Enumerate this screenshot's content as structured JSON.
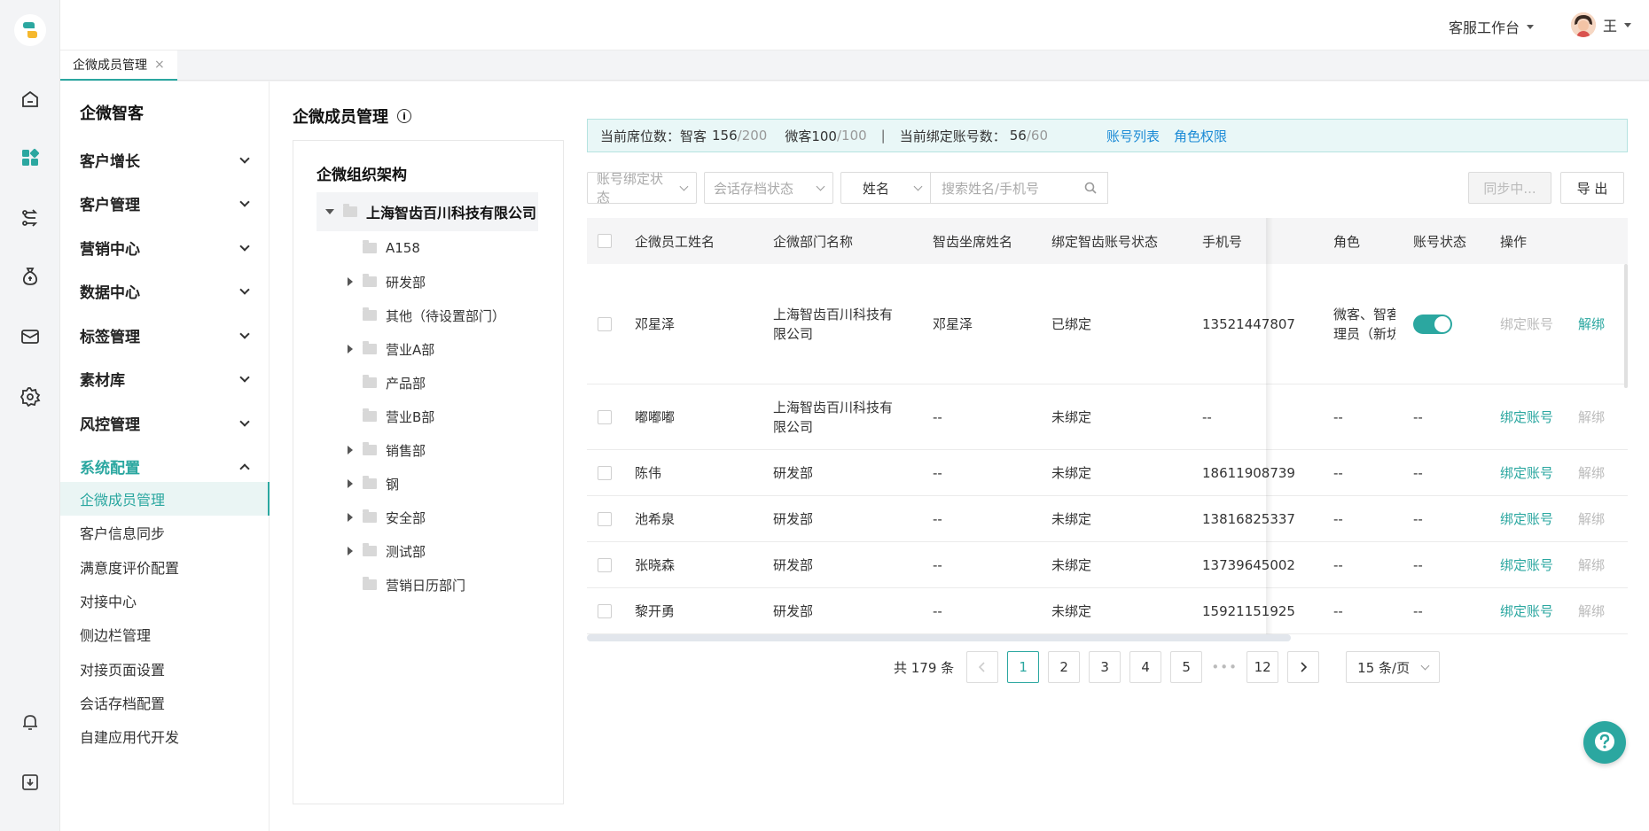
{
  "header": {
    "workspace_label": "客服工作台",
    "user_name": "王"
  },
  "tabs": [
    {
      "label": "企微成员管理",
      "close": "×"
    }
  ],
  "rail": {
    "icons": [
      "home-icon",
      "apps-icon",
      "flow-icon",
      "money-bag-icon",
      "mail-icon",
      "settings-icon",
      "bell-icon",
      "download-icon"
    ]
  },
  "sidebar": {
    "title": "企微智客",
    "groups": [
      {
        "label": "客户增长"
      },
      {
        "label": "客户管理"
      },
      {
        "label": "营销中心"
      },
      {
        "label": "数据中心"
      },
      {
        "label": "标签管理"
      },
      {
        "label": "素材库"
      },
      {
        "label": "风控管理"
      },
      {
        "label": "系统配置"
      }
    ],
    "items": [
      {
        "label": "企微成员管理"
      },
      {
        "label": "客户信息同步"
      },
      {
        "label": "满意度评价配置"
      },
      {
        "label": "对接中心"
      },
      {
        "label": "侧边栏管理"
      },
      {
        "label": "对接页面设置"
      },
      {
        "label": "会话存档配置"
      },
      {
        "label": "自建应用代开发"
      }
    ]
  },
  "page": {
    "title": "企微成员管理",
    "info_glyph": "i"
  },
  "tree": {
    "title": "企微组织架构",
    "root": "上海智齿百川科技有限公司",
    "nodes": [
      {
        "label": "A158"
      },
      {
        "label": "研发部"
      },
      {
        "label": "其他（待设置部门）"
      },
      {
        "label": "营业A部"
      },
      {
        "label": "产品部"
      },
      {
        "label": "营业B部"
      },
      {
        "label": "销售部"
      },
      {
        "label": "钢"
      },
      {
        "label": "安全部"
      },
      {
        "label": "测试部"
      },
      {
        "label": "营销日历部门"
      }
    ]
  },
  "banner": {
    "seat_label": "当前席位数：智客",
    "zhike_used": "156",
    "zhike_total": "/200",
    "weike_label": "微客100",
    "weike_total": "/100",
    "divider": "|",
    "bind_label": "当前绑定账号数：",
    "bind_used": "56",
    "bind_total": "/60",
    "link_accounts": "账号列表",
    "link_roles": "角色权限"
  },
  "filters": {
    "bind_status_placeholder": "账号绑定状态",
    "archive_status_placeholder": "会话存档状态",
    "field_select": "姓名",
    "search_placeholder": "搜索姓名/手机号"
  },
  "buttons": {
    "sync": "同步中...",
    "export": "导 出"
  },
  "table": {
    "headers": [
      "企微员工姓名",
      "企微部门名称",
      "智齿坐席姓名",
      "绑定智齿账号状态",
      "手机号",
      "角色",
      "账号状态",
      "操作"
    ],
    "rows": [
      {
        "name": "邓星泽",
        "dept1": "上海智齿百川科技有",
        "dept2": "限公司",
        "agent": "邓星泽",
        "bind": "已绑定",
        "phone": "13521447807",
        "role1": "微客、智客",
        "role2": "理员（新坊",
        "status": "",
        "action1": "绑定账号",
        "action2": "解绑"
      },
      {
        "name": "嘟嘟嘟",
        "dept1": "上海智齿百川科技有",
        "dept2": "限公司",
        "agent": "--",
        "bind": "未绑定",
        "phone": "--",
        "role1": "--",
        "role2": "",
        "status": "--",
        "action1": "绑定账号",
        "action2": "解绑"
      },
      {
        "name": "陈伟",
        "dept1": "研发部",
        "dept2": "",
        "agent": "--",
        "bind": "未绑定",
        "phone": "18611908739",
        "role1": "--",
        "role2": "",
        "status": "--",
        "action1": "绑定账号",
        "action2": "解绑"
      },
      {
        "name": "池希泉",
        "dept1": "研发部",
        "dept2": "",
        "agent": "--",
        "bind": "未绑定",
        "phone": "13816825337",
        "role1": "--",
        "role2": "",
        "status": "--",
        "action1": "绑定账号",
        "action2": "解绑"
      },
      {
        "name": "张晓森",
        "dept1": "研发部",
        "dept2": "",
        "agent": "--",
        "bind": "未绑定",
        "phone": "13739645002",
        "role1": "--",
        "role2": "",
        "status": "--",
        "action1": "绑定账号",
        "action2": "解绑"
      },
      {
        "name": "黎开勇",
        "dept1": "研发部",
        "dept2": "",
        "agent": "--",
        "bind": "未绑定",
        "phone": "15921151925",
        "role1": "--",
        "role2": "",
        "status": "--",
        "action1": "绑定账号",
        "action2": "解绑"
      }
    ]
  },
  "pagination": {
    "total": "共 179 条",
    "pages": [
      "1",
      "2",
      "3",
      "4",
      "5"
    ],
    "ellipsis": "•••",
    "last": "12",
    "page_size": "15 条/页",
    "current": "1"
  },
  "colors": {
    "accent": "#2ba7a0",
    "link": "#1c8bd6"
  }
}
